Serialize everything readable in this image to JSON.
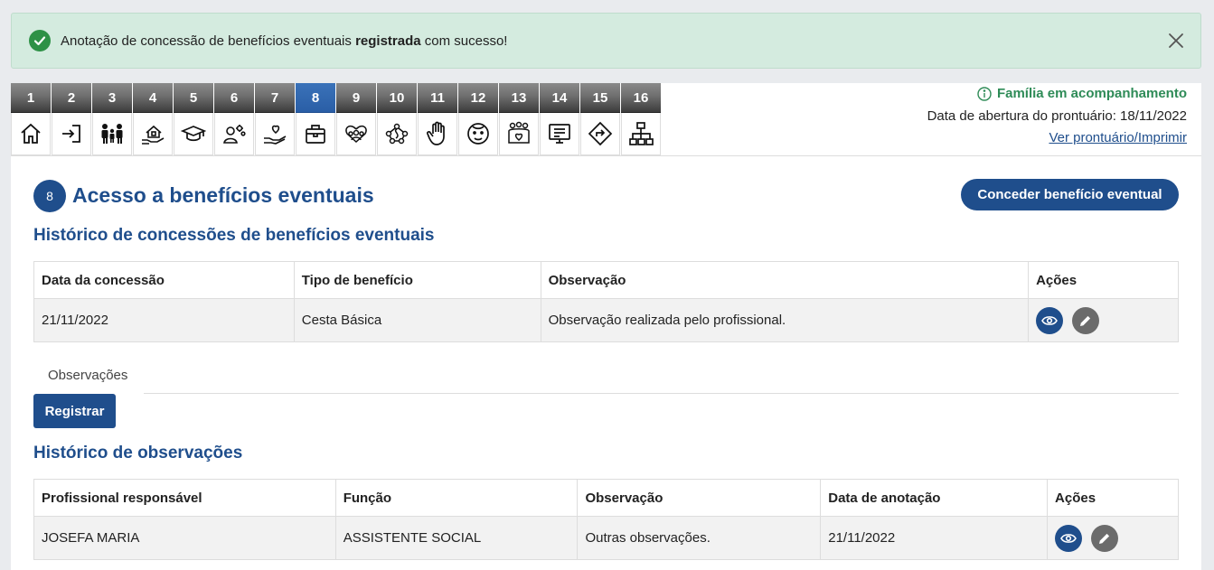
{
  "alert": {
    "text_before": "Anotação de concessão de benefícios eventuais ",
    "text_bold": "registrada",
    "text_after": " com sucesso!"
  },
  "tabs": [
    {
      "num": "1",
      "icon": "home-icon"
    },
    {
      "num": "2",
      "icon": "login-icon"
    },
    {
      "num": "3",
      "icon": "family-icon"
    },
    {
      "num": "4",
      "icon": "house-hand-icon"
    },
    {
      "num": "5",
      "icon": "graduation-cap-icon"
    },
    {
      "num": "6",
      "icon": "person-gears-icon"
    },
    {
      "num": "7",
      "icon": "hand-heart-icon"
    },
    {
      "num": "8",
      "icon": "briefcase-icon",
      "active": true
    },
    {
      "num": "9",
      "icon": "group-heart-icon"
    },
    {
      "num": "10",
      "icon": "network-people-icon"
    },
    {
      "num": "11",
      "icon": "hand-stop-icon"
    },
    {
      "num": "12",
      "icon": "face-icon"
    },
    {
      "num": "13",
      "icon": "community-heart-icon"
    },
    {
      "num": "14",
      "icon": "monitor-document-icon"
    },
    {
      "num": "15",
      "icon": "direction-sign-icon"
    },
    {
      "num": "16",
      "icon": "hierarchy-icon"
    }
  ],
  "header": {
    "status": "Família em acompanhamento",
    "abertura": "Data de abertura do prontuário: 18/11/2022",
    "link": "Ver prontuário/Imprimir"
  },
  "section": {
    "number": "8",
    "title": "Acesso a benefícios eventuais",
    "button": "Conceder benefício eventual"
  },
  "concessoes": {
    "title": "Histórico de concessões de benefícios eventuais",
    "headers": [
      "Data da concessão",
      "Tipo de benefício",
      "Observação",
      "Ações"
    ],
    "rows": [
      [
        "21/11/2022",
        "Cesta Básica",
        "Observação realizada pelo profissional."
      ]
    ]
  },
  "observacoes_tab": "Observações",
  "registrar": "Registrar",
  "historico_obs": {
    "title": "Histórico de observações",
    "headers": [
      "Profissional responsável",
      "Função",
      "Observação",
      "Data de anotação",
      "Ações"
    ],
    "rows": [
      [
        "JOSEFA MARIA",
        "ASSISTENTE SOCIAL",
        "Outras observações.",
        "21/11/2022"
      ]
    ]
  },
  "colors": {
    "primary": "#1f4e8c",
    "success": "#2e9146",
    "alert_bg": "#d4ebdf"
  }
}
